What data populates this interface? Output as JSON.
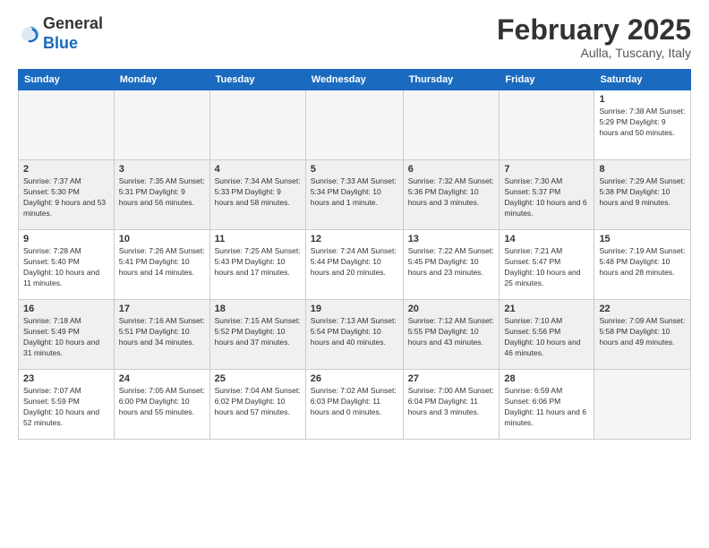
{
  "logo": {
    "general": "General",
    "blue": "Blue"
  },
  "header": {
    "month": "February 2025",
    "location": "Aulla, Tuscany, Italy"
  },
  "weekdays": [
    "Sunday",
    "Monday",
    "Tuesday",
    "Wednesday",
    "Thursday",
    "Friday",
    "Saturday"
  ],
  "weeks": [
    {
      "shaded": false,
      "days": [
        {
          "num": "",
          "info": ""
        },
        {
          "num": "",
          "info": ""
        },
        {
          "num": "",
          "info": ""
        },
        {
          "num": "",
          "info": ""
        },
        {
          "num": "",
          "info": ""
        },
        {
          "num": "",
          "info": ""
        },
        {
          "num": "1",
          "info": "Sunrise: 7:38 AM\nSunset: 5:29 PM\nDaylight: 9 hours\nand 50 minutes."
        }
      ]
    },
    {
      "shaded": true,
      "days": [
        {
          "num": "2",
          "info": "Sunrise: 7:37 AM\nSunset: 5:30 PM\nDaylight: 9 hours\nand 53 minutes."
        },
        {
          "num": "3",
          "info": "Sunrise: 7:35 AM\nSunset: 5:31 PM\nDaylight: 9 hours\nand 56 minutes."
        },
        {
          "num": "4",
          "info": "Sunrise: 7:34 AM\nSunset: 5:33 PM\nDaylight: 9 hours\nand 58 minutes."
        },
        {
          "num": "5",
          "info": "Sunrise: 7:33 AM\nSunset: 5:34 PM\nDaylight: 10 hours\nand 1 minute."
        },
        {
          "num": "6",
          "info": "Sunrise: 7:32 AM\nSunset: 5:36 PM\nDaylight: 10 hours\nand 3 minutes."
        },
        {
          "num": "7",
          "info": "Sunrise: 7:30 AM\nSunset: 5:37 PM\nDaylight: 10 hours\nand 6 minutes."
        },
        {
          "num": "8",
          "info": "Sunrise: 7:29 AM\nSunset: 5:38 PM\nDaylight: 10 hours\nand 9 minutes."
        }
      ]
    },
    {
      "shaded": false,
      "days": [
        {
          "num": "9",
          "info": "Sunrise: 7:28 AM\nSunset: 5:40 PM\nDaylight: 10 hours\nand 11 minutes."
        },
        {
          "num": "10",
          "info": "Sunrise: 7:26 AM\nSunset: 5:41 PM\nDaylight: 10 hours\nand 14 minutes."
        },
        {
          "num": "11",
          "info": "Sunrise: 7:25 AM\nSunset: 5:43 PM\nDaylight: 10 hours\nand 17 minutes."
        },
        {
          "num": "12",
          "info": "Sunrise: 7:24 AM\nSunset: 5:44 PM\nDaylight: 10 hours\nand 20 minutes."
        },
        {
          "num": "13",
          "info": "Sunrise: 7:22 AM\nSunset: 5:45 PM\nDaylight: 10 hours\nand 23 minutes."
        },
        {
          "num": "14",
          "info": "Sunrise: 7:21 AM\nSunset: 5:47 PM\nDaylight: 10 hours\nand 25 minutes."
        },
        {
          "num": "15",
          "info": "Sunrise: 7:19 AM\nSunset: 5:48 PM\nDaylight: 10 hours\nand 28 minutes."
        }
      ]
    },
    {
      "shaded": true,
      "days": [
        {
          "num": "16",
          "info": "Sunrise: 7:18 AM\nSunset: 5:49 PM\nDaylight: 10 hours\nand 31 minutes."
        },
        {
          "num": "17",
          "info": "Sunrise: 7:16 AM\nSunset: 5:51 PM\nDaylight: 10 hours\nand 34 minutes."
        },
        {
          "num": "18",
          "info": "Sunrise: 7:15 AM\nSunset: 5:52 PM\nDaylight: 10 hours\nand 37 minutes."
        },
        {
          "num": "19",
          "info": "Sunrise: 7:13 AM\nSunset: 5:54 PM\nDaylight: 10 hours\nand 40 minutes."
        },
        {
          "num": "20",
          "info": "Sunrise: 7:12 AM\nSunset: 5:55 PM\nDaylight: 10 hours\nand 43 minutes."
        },
        {
          "num": "21",
          "info": "Sunrise: 7:10 AM\nSunset: 5:56 PM\nDaylight: 10 hours\nand 46 minutes."
        },
        {
          "num": "22",
          "info": "Sunrise: 7:09 AM\nSunset: 5:58 PM\nDaylight: 10 hours\nand 49 minutes."
        }
      ]
    },
    {
      "shaded": false,
      "days": [
        {
          "num": "23",
          "info": "Sunrise: 7:07 AM\nSunset: 5:59 PM\nDaylight: 10 hours\nand 52 minutes."
        },
        {
          "num": "24",
          "info": "Sunrise: 7:05 AM\nSunset: 6:00 PM\nDaylight: 10 hours\nand 55 minutes."
        },
        {
          "num": "25",
          "info": "Sunrise: 7:04 AM\nSunset: 6:02 PM\nDaylight: 10 hours\nand 57 minutes."
        },
        {
          "num": "26",
          "info": "Sunrise: 7:02 AM\nSunset: 6:03 PM\nDaylight: 11 hours\nand 0 minutes."
        },
        {
          "num": "27",
          "info": "Sunrise: 7:00 AM\nSunset: 6:04 PM\nDaylight: 11 hours\nand 3 minutes."
        },
        {
          "num": "28",
          "info": "Sunrise: 6:59 AM\nSunset: 6:06 PM\nDaylight: 11 hours\nand 6 minutes."
        },
        {
          "num": "",
          "info": ""
        }
      ]
    }
  ]
}
